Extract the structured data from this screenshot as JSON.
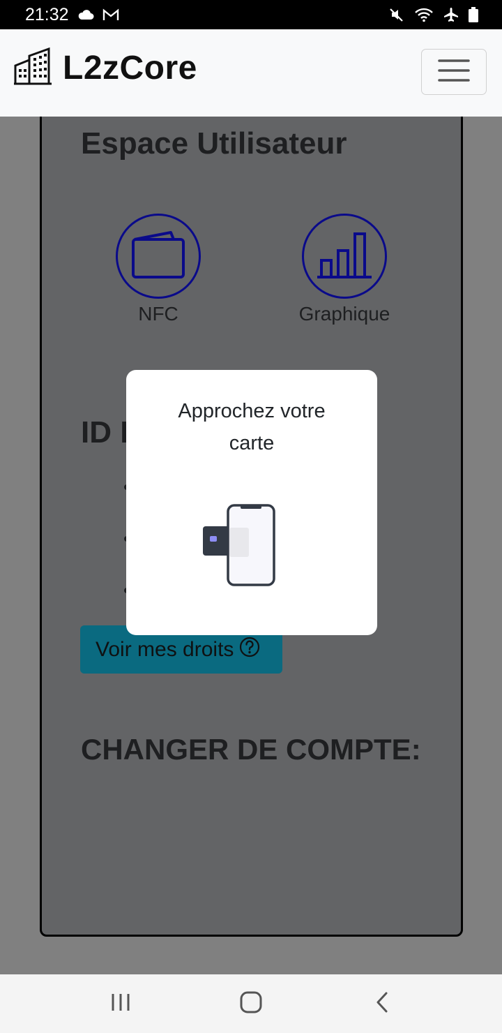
{
  "status_bar": {
    "time": "21:32",
    "left_icons": [
      "cloud-icon",
      "gmail-icon"
    ],
    "right_icons": [
      "mute-icon",
      "wifi-icon",
      "airplane-icon",
      "battery-icon"
    ]
  },
  "navbar": {
    "brand": "L2zCore",
    "brand_icon": "buildings-icon",
    "menu_icon": "hamburger-icon"
  },
  "page": {
    "title": "Espace Utilisateur",
    "tiles": [
      {
        "label": "NFC",
        "icon": "wallet-icon"
      },
      {
        "label": "Graphique",
        "icon": "bar-chart-icon"
      }
    ],
    "id_heading_visible": "ID D",
    "rights_button": "Voir mes droits",
    "rights_button_icon": "question-circle-icon",
    "switch_account_title": "CHANGER DE COMPTE:"
  },
  "modal": {
    "line1": "Approchez votre",
    "line2": "carte",
    "illustration": "phone-card-tap-icon"
  },
  "system_nav": {
    "recent": "recent-apps-icon",
    "home": "home-icon",
    "back": "back-icon"
  },
  "colors": {
    "overlay_gray": "#808080",
    "card_bg": "#636466",
    "icon_navy": "#0a0a8a",
    "button_teal": "#0a6a80"
  }
}
